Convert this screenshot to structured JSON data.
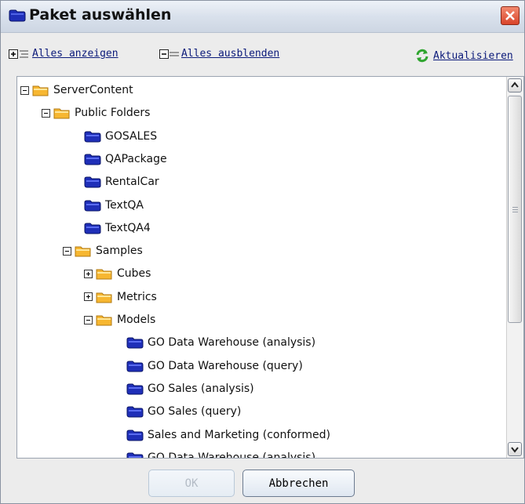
{
  "dialog": {
    "title": "Paket auswählen"
  },
  "toolbar": {
    "show_all_label": "Alles anzeigen",
    "hide_all_label": "Alles ausblenden",
    "refresh_label": "Aktualisieren"
  },
  "tree": {
    "items": [
      {
        "label": "ServerContent",
        "type": "folder",
        "state": "expanded"
      },
      {
        "label": "Public Folders",
        "type": "folder",
        "state": "expanded"
      },
      {
        "label": "GOSALES",
        "type": "package"
      },
      {
        "label": "QAPackage",
        "type": "package"
      },
      {
        "label": "RentalCar",
        "type": "package"
      },
      {
        "label": "TextQA",
        "type": "package"
      },
      {
        "label": "TextQA4",
        "type": "package"
      },
      {
        "label": "Samples",
        "type": "folder",
        "state": "expanded"
      },
      {
        "label": "Cubes",
        "type": "folder",
        "state": "collapsed"
      },
      {
        "label": "Metrics",
        "type": "folder",
        "state": "collapsed"
      },
      {
        "label": "Models",
        "type": "folder",
        "state": "expanded"
      },
      {
        "label": "GO Data Warehouse (analysis)",
        "type": "package"
      },
      {
        "label": "GO Data Warehouse (query)",
        "type": "package"
      },
      {
        "label": "GO Sales (analysis)",
        "type": "package"
      },
      {
        "label": "GO Sales (query)",
        "type": "package"
      },
      {
        "label": "Sales and Marketing (conformed)",
        "type": "package"
      },
      {
        "label": "GO Data Warehouse (analysis)",
        "type": "package"
      }
    ]
  },
  "buttons": {
    "ok_label": "OK",
    "cancel_label": "Abbrechen"
  },
  "colors": {
    "folder": "#f7b731",
    "package": "#1f2fb8",
    "close": "#d9442a"
  }
}
